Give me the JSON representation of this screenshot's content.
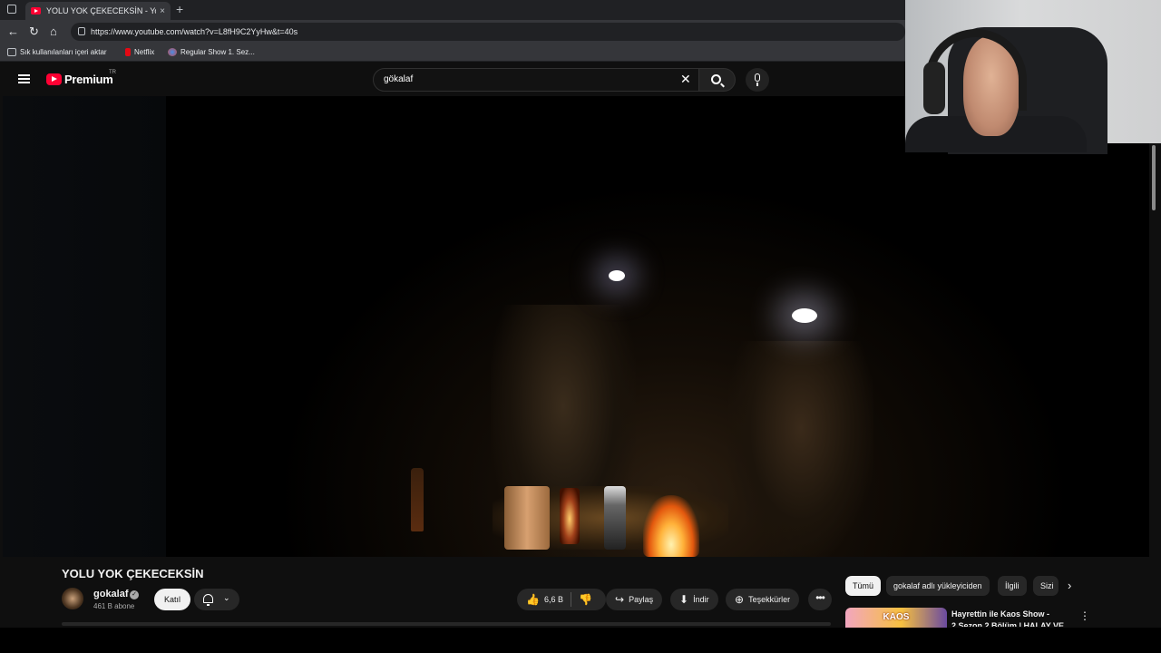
{
  "browser": {
    "tab_title": "YOLU YOK ÇEKECEKSİN - YouTube",
    "tab_close": "×",
    "new_tab": "+",
    "url": "https://www.youtube.com/watch?v=L8fH9C2YyHw&t=40s",
    "nav_back": "←",
    "nav_reload": "↻",
    "nav_home": "⌂",
    "bookmarks": [
      {
        "label": "Sık kullanılanları içeri aktar"
      },
      {
        "label": "Netflix"
      },
      {
        "label": "Regular Show 1. Sez..."
      }
    ]
  },
  "youtube": {
    "logo_text": "Premium",
    "region": "TR",
    "search_value": "gökalaf",
    "clear_icon": "✕"
  },
  "video": {
    "title": "YOLU YOK ÇEKECEKSİN",
    "channel": {
      "name": "gokalaf",
      "verified_mark": "✓",
      "subscribers": "461 B abone",
      "join_label": "Katıl",
      "bell_chevron": "⌄"
    },
    "actions": {
      "like_count": "6,6 B",
      "share_label": "Paylaş",
      "download_label": "İndir",
      "thanks_label": "Teşekkürler",
      "more_label": "•••"
    }
  },
  "sidebar": {
    "chips": [
      "Tümü",
      "gokalaf adlı yükleyiciden",
      "İlgili",
      "Sizi"
    ],
    "chips_next": "›",
    "recommendation": {
      "thumb_text": "KAOS",
      "title": "Hayrettin ile Kaos Show - 2.Sezon 2.Bölüm | HALAY VE",
      "menu": "⋮"
    }
  },
  "icons": {
    "like": "👍",
    "dislike": "👎",
    "share": "↪",
    "download": "⬇",
    "thanks": "⊕"
  }
}
